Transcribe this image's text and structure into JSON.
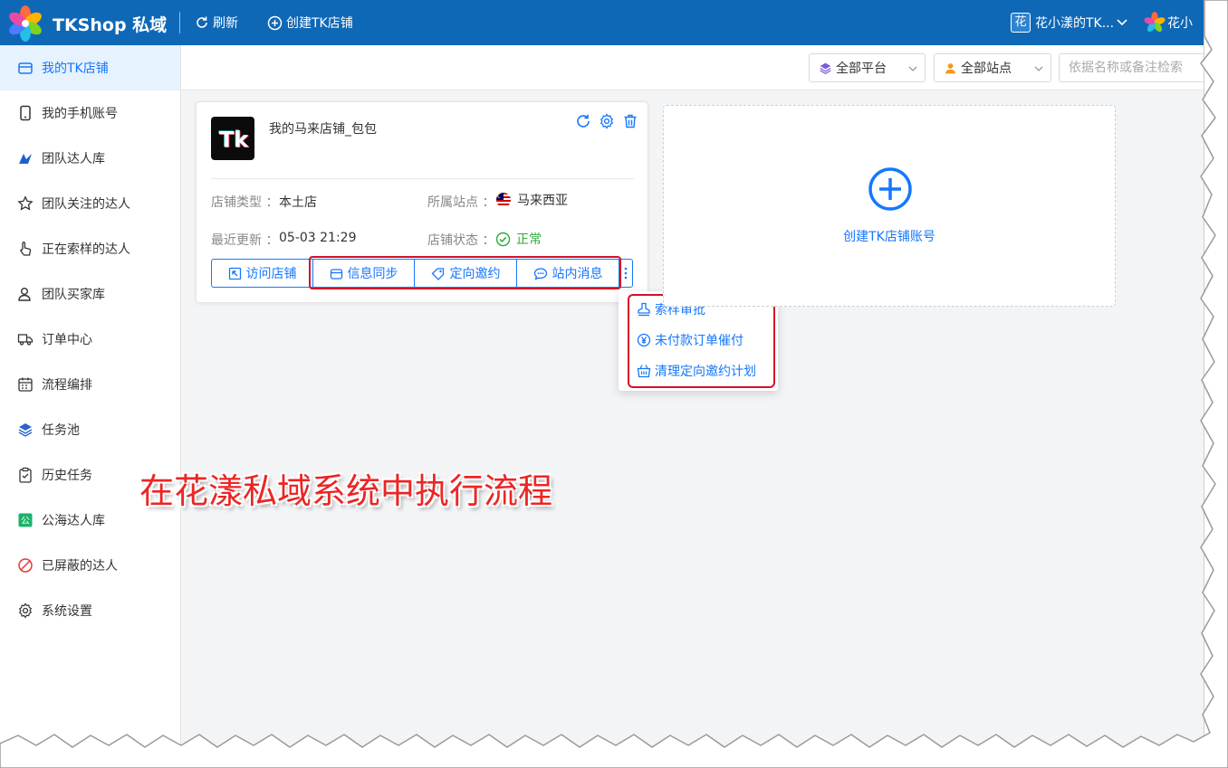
{
  "header": {
    "app_title": "TKShop 私域",
    "refresh_label": "刷新",
    "create_shop_label": "创建TK店铺",
    "user_badge": "花",
    "user_name": "花小漾的TK...",
    "org_name": "花小"
  },
  "sidebar": {
    "items": [
      {
        "label": "我的TK店铺",
        "icon": "store-icon",
        "active": true
      },
      {
        "label": "我的手机账号",
        "icon": "phone-icon"
      },
      {
        "label": "团队达人库",
        "icon": "creator-library-icon"
      },
      {
        "label": "团队关注的达人",
        "icon": "star-icon"
      },
      {
        "label": "正在索样的达人",
        "icon": "hand-pointer-icon"
      },
      {
        "label": "团队买家库",
        "icon": "buyer-icon"
      },
      {
        "label": "订单中心",
        "icon": "truck-icon"
      },
      {
        "label": "流程编排",
        "icon": "calendar-icon"
      },
      {
        "label": "任务池",
        "icon": "layers-icon"
      },
      {
        "label": "历史任务",
        "icon": "clipboard-icon"
      },
      {
        "label": "公海达人库",
        "icon": "public-pool-icon"
      },
      {
        "label": "已屏蔽的达人",
        "icon": "block-icon"
      },
      {
        "label": "系统设置",
        "icon": "gear-icon"
      }
    ]
  },
  "filters": {
    "platform": "全部平台",
    "site": "全部站点",
    "search_placeholder": "依据名称或备注检索"
  },
  "shop_card": {
    "name": "我的马来店铺_包包",
    "logo_text": "Tk",
    "type_label": "店铺类型 ：",
    "type_value": "本土店",
    "site_label": "所属站点 ：",
    "site_value": "马来西亚",
    "updated_label": "最近更新 ：",
    "updated_value": "05-03 21:29",
    "status_label": "店铺状态 ：",
    "status_value": "正常",
    "buttons": {
      "visit": "访问店铺",
      "sync": "信息同步",
      "invite": "定向邀约",
      "message": "站内消息"
    }
  },
  "more_menu": {
    "items": [
      "索样审批",
      "未付款订单催付",
      "清理定向邀约计划"
    ]
  },
  "create_card": {
    "label": "创建TK店铺账号"
  },
  "caption": "在花漾私域系统中执行流程",
  "colors": {
    "topbar": "#0f68b6",
    "accent": "#1677ff",
    "highlight": "#d3122a",
    "status_ok": "#2eaa3e",
    "caption": "#ec2525"
  }
}
